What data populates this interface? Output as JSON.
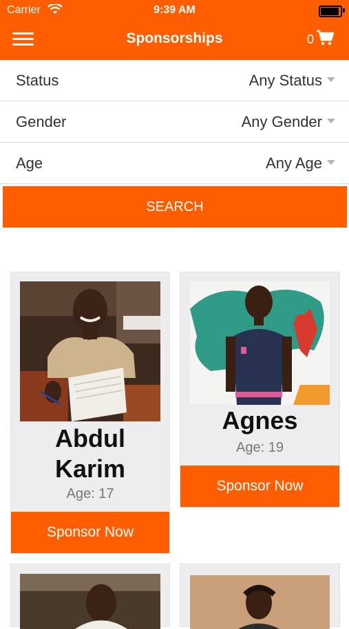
{
  "status_bar": {
    "carrier": "Carrier",
    "time": "9:39 AM"
  },
  "header": {
    "title": "Sponsorships",
    "cart_count": "0"
  },
  "filters": [
    {
      "label": "Status",
      "value": "Any Status"
    },
    {
      "label": "Gender",
      "value": "Any Gender"
    },
    {
      "label": "Age",
      "value": "Any Age"
    }
  ],
  "search": {
    "label": "SEARCH"
  },
  "children": [
    {
      "name_line1": "Abdul",
      "name_line2": "Karim",
      "age": "Age: 17",
      "button": "Sponsor Now"
    },
    {
      "name": "Agnes",
      "age": "Age: 19",
      "button": "Sponsor Now"
    }
  ],
  "colors": {
    "accent": "#ff5e00",
    "card_bg": "#ededef",
    "divider": "#d9d9d9"
  }
}
